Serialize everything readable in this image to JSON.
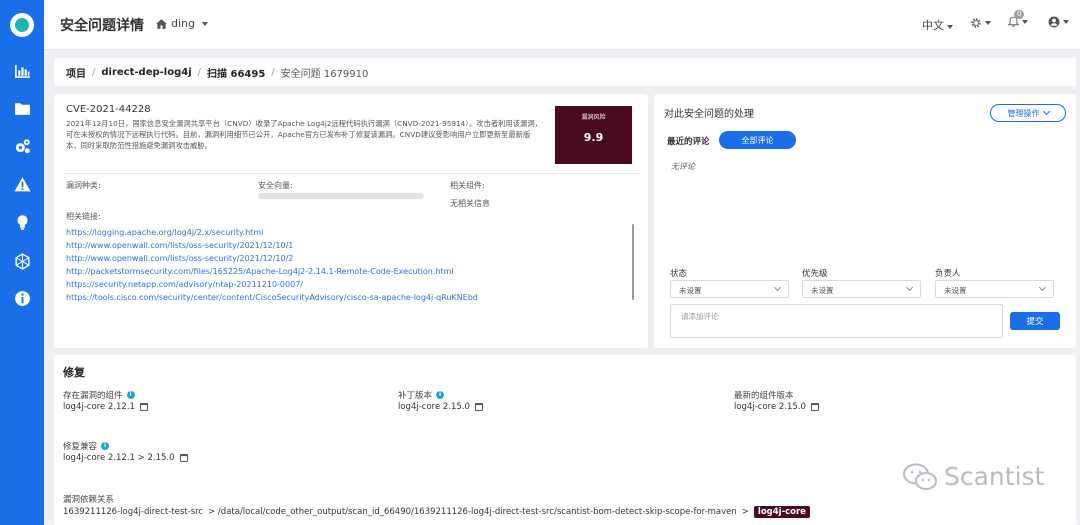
{
  "header": {
    "title": "安全问题详情",
    "workspace": "ding",
    "language": "中文",
    "notification_count": "0"
  },
  "sidebar": {
    "items": [
      {
        "icon": "bar-chart-icon"
      },
      {
        "icon": "folder-icon"
      },
      {
        "icon": "gears-icon"
      },
      {
        "icon": "warning-icon"
      },
      {
        "icon": "lightbulb-icon"
      },
      {
        "icon": "network-icon"
      },
      {
        "icon": "info-icon"
      }
    ]
  },
  "breadcrumb": {
    "project": "项目",
    "repo": "direct-dep-log4j",
    "scan": "扫描 66495",
    "current": "安全问题 1679910"
  },
  "vuln": {
    "cve_id": "CVE-2021-44228",
    "description": "2021年12月10日，国家信息安全漏洞共享平台（CNVD）收录了Apache Log4j2远程代码执行漏洞（CNVD-2021-95914）。攻击者利用该漏洞，可在未授权的情况下远程执行代码。目前，漏洞利用细节已公开，Apache官方已发布补丁修复该漏洞。CNVD建议受影响用户立即更新至最新版本，同时采取防范性措施避免漏洞攻击威胁。",
    "risk_label": "漏洞风险",
    "risk_score": "9.9",
    "type_label": "漏洞种类:",
    "vector_label": "安全向量:",
    "component_label": "相关组件:",
    "component_value": "无相关信息",
    "links_label": "相关链接:",
    "links": [
      "https://logging.apache.org/log4j/2.x/security.html",
      "http://www.openwall.com/lists/oss-security/2021/12/10/1",
      "http://www.openwall.com/lists/oss-security/2021/12/10/2",
      "http://packetstormsecurity.com/files/165225/Apache-Log4j2-2.14.1-Remote-Code-Execution.html",
      "https://security.netapp.com/advisory/ntap-20211210-0007/",
      "https://tools.cisco.com/security/center/content/CiscoSecurityAdvisory/cisco-sa-apache-log4j-qRuKNEbd"
    ]
  },
  "handling": {
    "title": "对此安全问题的处理",
    "manage_button": "管理操作",
    "recent_comments": "最近的评论",
    "all_comments_button": "全部评论",
    "no_comment": "无评论",
    "status_label": "状态",
    "status_value": "未设置",
    "priority_label": "优先级",
    "priority_value": "未设置",
    "owner_label": "负责人",
    "owner_value": "未设置",
    "comment_placeholder": "请添加评论",
    "submit_button": "提交"
  },
  "fix": {
    "title": "修复",
    "vulnerable_component_label": "存在漏洞的组件",
    "vulnerable_component_value": "log4j-core 2.12.1",
    "patch_label": "补丁版本",
    "patch_value": "log4j-core 2.15.0",
    "latest_label": "最新的组件版本",
    "latest_value": "log4j-core 2.15.0",
    "compat_label": "修复兼容",
    "compat_value": "log4j-core 2.12.1 > 2.15.0",
    "dep_label": "漏洞依赖关系",
    "dep_root": "1639211126-log4j-direct-test-src",
    "dep_path": "> /data/local/code_other_output/scan_id_66490/1639211126-log4j-direct-test-src/scantist-bom-detect-skip-scope-for-maven",
    "dep_arrow": ">",
    "dep_target": "log4j-core"
  },
  "watermark": "Scantist"
}
